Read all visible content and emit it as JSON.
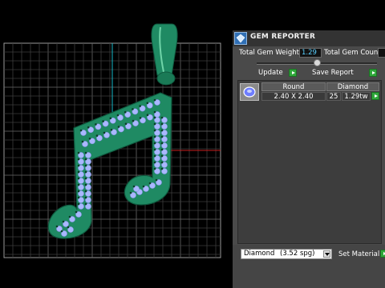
{
  "panel": {
    "title": "GEM REPORTER",
    "total_weight_label": "Total Gem Weight",
    "total_weight_value": "1.29",
    "total_count_label": "Total Gem Count",
    "total_count_value": "",
    "update_label": "Update",
    "save_label": "Save Report"
  },
  "gem_table": {
    "headers": [
      "Round",
      "Diamond"
    ],
    "row": {
      "size": "2.40 X 2.40",
      "count": "25",
      "weight": "1.29tw"
    }
  },
  "material": {
    "selected": "Diamond",
    "sg": "(3.52 spg)",
    "set_label": "Set Material"
  },
  "colors": {
    "model_green": "#1f8a63",
    "gem_blue": "#a9b7ff",
    "accent_green": "#2fa83a",
    "value_cyan": "#5ad0ff"
  }
}
